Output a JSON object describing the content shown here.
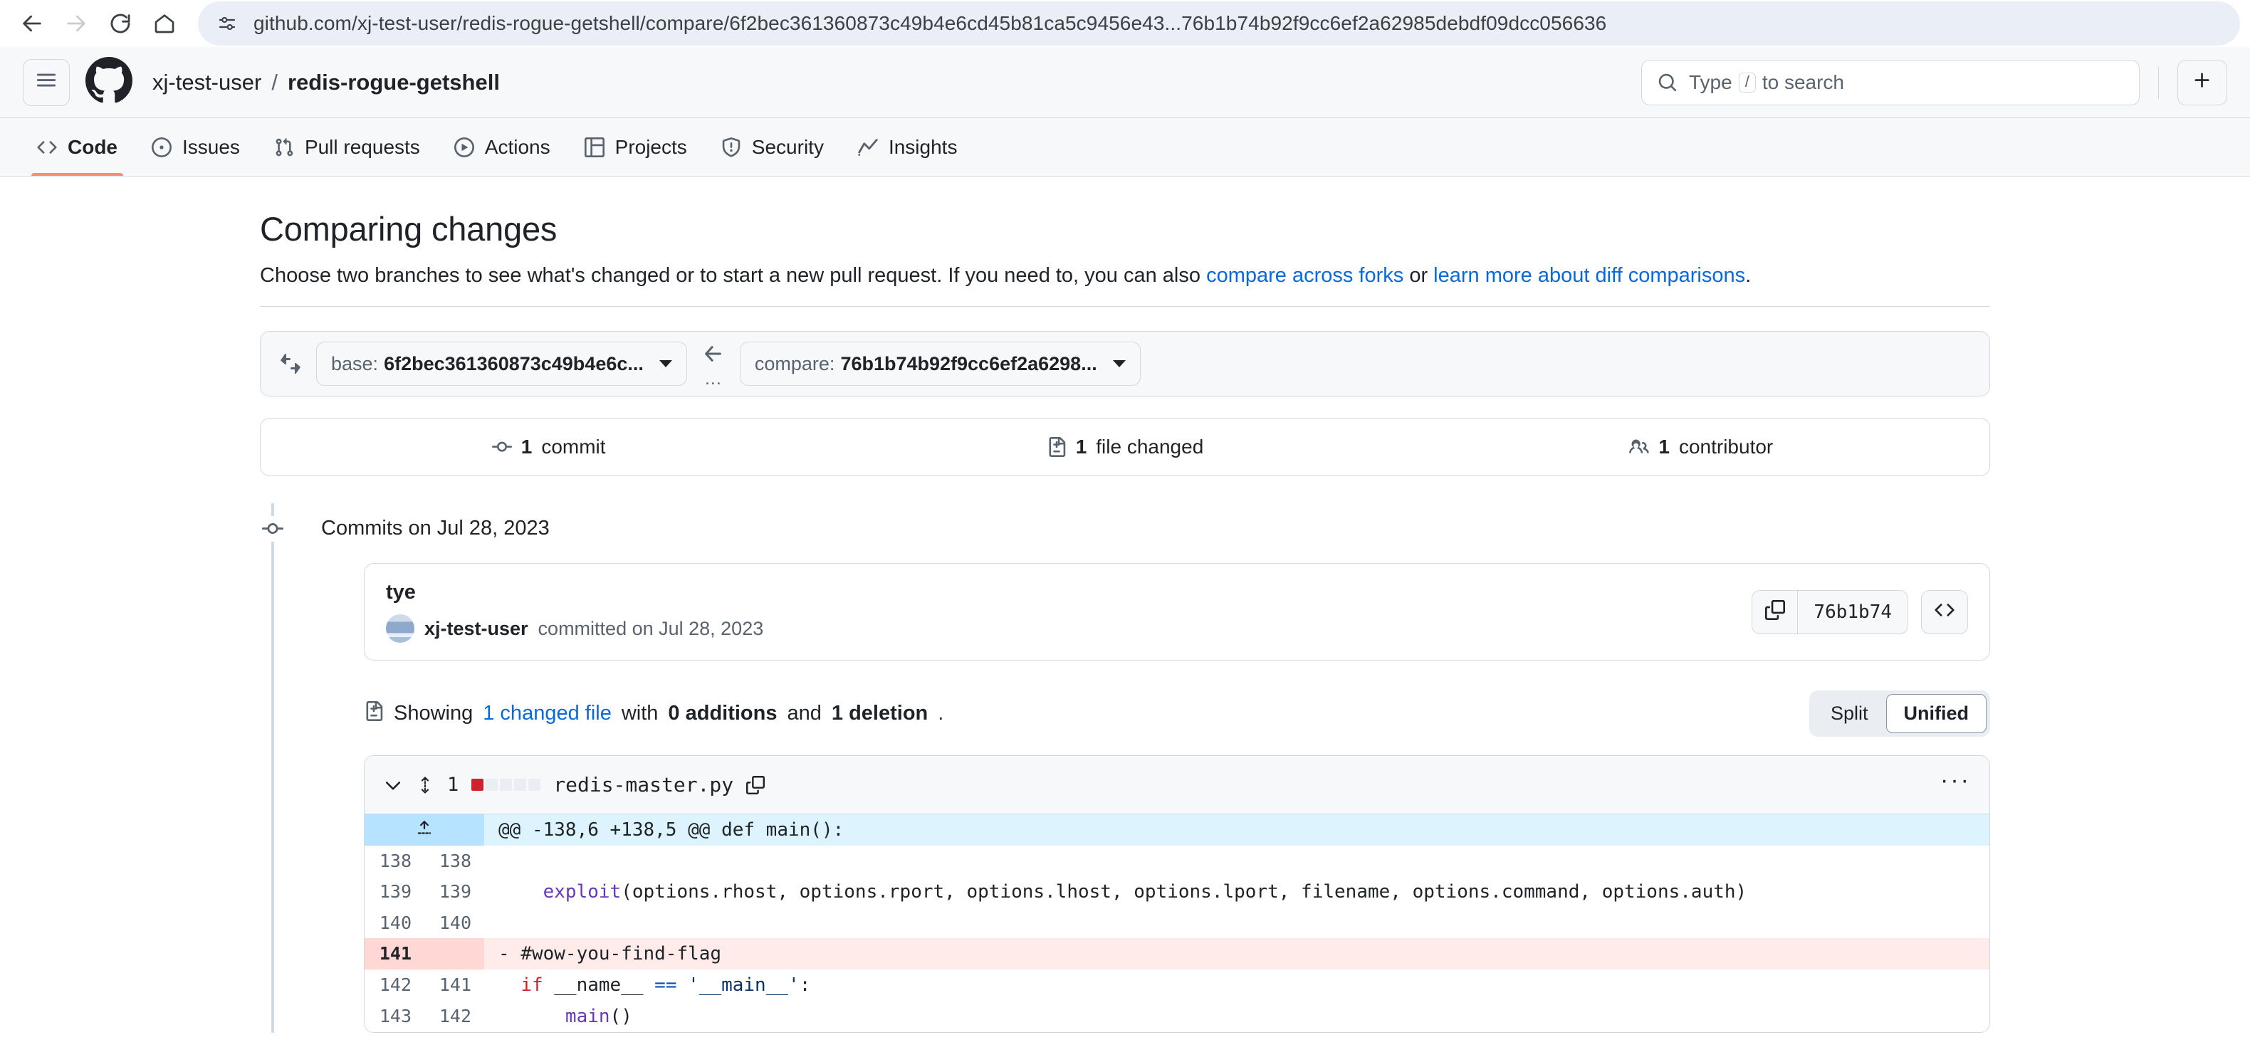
{
  "browser": {
    "url": "github.com/xj-test-user/redis-rogue-getshell/compare/6f2bec361360873c49b4e6cd45b81ca5c9456e43...76b1b74b92f9cc6ef2a62985debdf09dcc056636",
    "back_icon": "back-arrow-icon",
    "forward_icon": "forward-arrow-icon",
    "reload_icon": "reload-icon",
    "home_icon": "home-icon",
    "site_info_icon": "site-settings-icon"
  },
  "header": {
    "menu_icon": "hamburger-menu-icon",
    "logo_icon": "github-logo-icon",
    "owner": "xj-test-user",
    "separator": "/",
    "repo": "redis-rogue-getshell",
    "search": {
      "icon": "search-icon",
      "placeholder_prefix": "Type",
      "placeholder_key": "/",
      "placeholder_suffix": "to search",
      "placeholder_full": "Type / to search"
    },
    "plus_label": "+"
  },
  "repo_nav": {
    "tabs": [
      {
        "label": "Code",
        "icon": "code-icon",
        "active": true
      },
      {
        "label": "Issues",
        "icon": "issue-opened-icon",
        "active": false
      },
      {
        "label": "Pull requests",
        "icon": "git-pull-request-icon",
        "active": false
      },
      {
        "label": "Actions",
        "icon": "play-icon",
        "active": false
      },
      {
        "label": "Projects",
        "icon": "table-icon",
        "active": false
      },
      {
        "label": "Security",
        "icon": "shield-icon",
        "active": false
      },
      {
        "label": "Insights",
        "icon": "graph-icon",
        "active": false
      }
    ],
    "active_accent": "#fd8c73"
  },
  "page": {
    "title": "Comparing changes",
    "description_part1": "Choose two branches to see what's changed or to start a new pull request. If you need to, you can also ",
    "link_forks": "compare across forks",
    "description_or": " or ",
    "link_diff": "learn more about diff comparisons",
    "description_end": "."
  },
  "compare_bar": {
    "swap_icon": "arrow-switch-icon",
    "base_prefix": "base:",
    "base_value": "6f2bec361360873c49b4e6c...",
    "arrow_icon": "arrow-left-icon",
    "ellipsis": "...",
    "compare_prefix": "compare:",
    "compare_value": "76b1b74b92f9cc6ef2a6298..."
  },
  "stats": [
    {
      "icon": "git-commit-icon",
      "count": "1",
      "label": "commit",
      "name": "commits-stat"
    },
    {
      "icon": "file-diff-icon",
      "count": "1",
      "label": "file changed",
      "name": "files-changed-stat"
    },
    {
      "icon": "people-icon",
      "count": "1",
      "label": "contributor",
      "name": "contributors-stat"
    }
  ],
  "timeline": {
    "heading": "Commits on Jul 28, 2023",
    "commit": {
      "message": "tye",
      "author": "xj-test-user",
      "committed_text": "committed on Jul 28, 2023",
      "copy_icon": "copy-icon",
      "sha": "76b1b74",
      "browse_code_icon": "code-icon"
    }
  },
  "diff_summary": {
    "icon": "file-diff-icon",
    "showing": "Showing",
    "changed_file_link": "1 changed file",
    "with": "with",
    "additions": "0 additions",
    "and": "and",
    "deletions": "1 deletion",
    "period": ".",
    "toggle": {
      "split": "Split",
      "unified": "Unified",
      "active": "Unified"
    }
  },
  "file_diff": {
    "chevron_icon": "chevron-down-icon",
    "drag_icon": "drag-handle-icon",
    "change_count": "1",
    "diffstat_blocks": [
      "del",
      "neutral",
      "neutral",
      "neutral",
      "neutral"
    ],
    "file_name": "redis-master.py",
    "copy_icon": "copy-path-icon",
    "kebab_icon": "kebab-horizontal-icon",
    "hunk_header": "@@ -138,6 +138,5 @@ def main():",
    "expand_icon": "unfold-up-icon",
    "rows": [
      {
        "type": "ctx",
        "old": "138",
        "new": "138",
        "code": ""
      },
      {
        "type": "ctx",
        "old": "139",
        "new": "139",
        "code": "    exploit(options.rhost, options.rport, options.lhost, options.lport, filename, options.command, options.auth)"
      },
      {
        "type": "ctx",
        "old": "140",
        "new": "140",
        "code": ""
      },
      {
        "type": "del",
        "old": "141",
        "new": "",
        "code": "- #wow-you-find-flag"
      },
      {
        "type": "ctx",
        "old": "142",
        "new": "141",
        "code": "  if __name__ == '__main__':"
      },
      {
        "type": "ctx",
        "old": "143",
        "new": "142",
        "code": "      main()"
      }
    ]
  },
  "colors": {
    "accent_blue": "#0969da",
    "tab_accent": "#fd8c73",
    "deletion_bg": "#ffebe9",
    "deletion_gutter": "#ffd7d5",
    "hunk_bg": "#ddf4ff",
    "hunk_gutter": "#b6e3ff",
    "header_bg": "#f6f8fa",
    "border": "#d1d9e0"
  }
}
